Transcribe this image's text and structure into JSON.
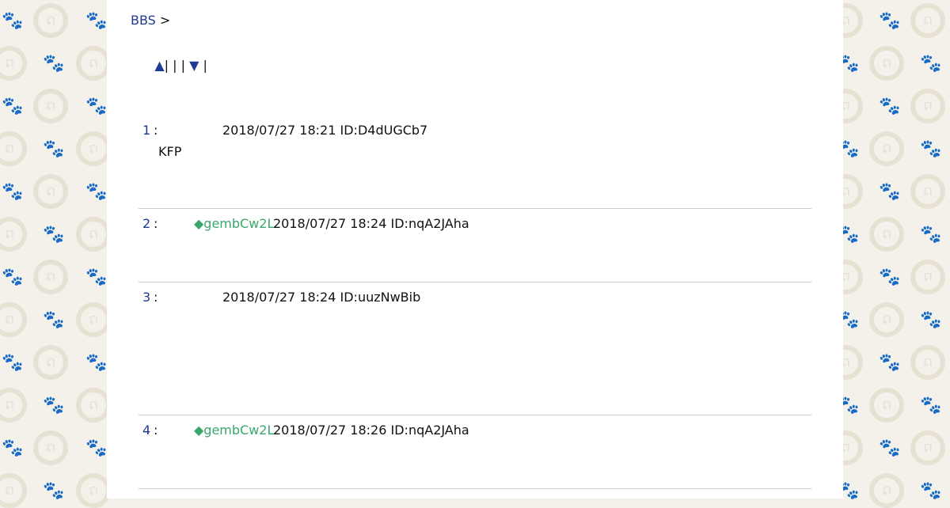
{
  "breadcrumb": {
    "bbs": "BBS",
    "sep": ">"
  },
  "nav": {
    "up": "▲",
    "bars": "| | |",
    "down": "▼",
    "tail": "|"
  },
  "posts": [
    {
      "num": "1",
      "colon": ":",
      "trip": "",
      "datetime": "2018/07/27 18:21",
      "id": "ID:D4dUGCb7",
      "body": "KFP"
    },
    {
      "num": "2",
      "colon": ":",
      "trip": "◆gembCw2L",
      "datetime": "2018/07/27 18:24",
      "id": "ID:nqA2JAha",
      "body": ""
    },
    {
      "num": "3",
      "colon": ":",
      "trip": "",
      "datetime": "2018/07/27 18:24",
      "id": "ID:uuzNwBib",
      "body": ""
    },
    {
      "num": "4",
      "colon": ":",
      "trip": "◆gembCw2L",
      "datetime": "2018/07/27 18:26",
      "id": "ID:nqA2JAha",
      "body": ""
    }
  ],
  "colors": {
    "link": "#1f3a93",
    "trip": "#3aa76d",
    "background": "#f4f1ea"
  },
  "icons": {
    "background_pattern": [
      "paw-print-icon",
      "cat-face-icon"
    ]
  }
}
